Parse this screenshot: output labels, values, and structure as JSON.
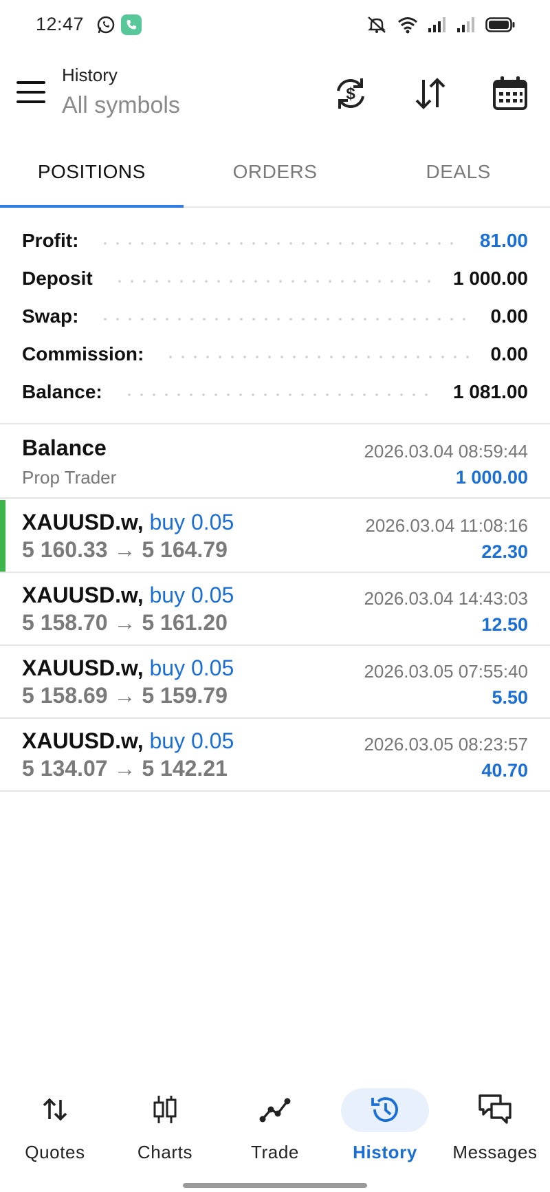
{
  "status_bar": {
    "time": "12:47",
    "icons": [
      "whatsapp-icon",
      "call-icon",
      "mute-icon",
      "wifi-icon",
      "signal-icon",
      "signal-icon",
      "battery-icon"
    ]
  },
  "header": {
    "title": "History",
    "subtitle": "All symbols",
    "actions": [
      "currency-sync-icon",
      "sort-icon",
      "calendar-icon"
    ]
  },
  "tabs": [
    {
      "label": "POSITIONS",
      "active": true
    },
    {
      "label": "ORDERS",
      "active": false
    },
    {
      "label": "DEALS",
      "active": false
    }
  ],
  "summary": {
    "profit": {
      "label": "Profit:",
      "value": "81.00"
    },
    "deposit": {
      "label": "Deposit",
      "value": "1 000.00"
    },
    "swap": {
      "label": "Swap:",
      "value": "0.00"
    },
    "commission": {
      "label": "Commission:",
      "value": "0.00"
    },
    "balance": {
      "label": "Balance:",
      "value": "1 081.00"
    }
  },
  "balance_entry": {
    "title": "Balance",
    "subtitle": "Prop Trader",
    "time": "2026.03.04 08:59:44",
    "amount": "1 000.00"
  },
  "positions": [
    {
      "symbol": "XAUUSD.w,",
      "type": "buy 0.05",
      "prices": "5 160.33 → 5 164.79",
      "time": "2026.03.04 11:08:16",
      "profit": "22.30"
    },
    {
      "symbol": "XAUUSD.w,",
      "type": "buy 0.05",
      "prices": "5 158.70 → 5 161.20",
      "time": "2026.03.04 14:43:03",
      "profit": "12.50"
    },
    {
      "symbol": "XAUUSD.w,",
      "type": "buy 0.05",
      "prices": "5 158.69 → 5 159.79",
      "time": "2026.03.05 07:55:40",
      "profit": "5.50"
    },
    {
      "symbol": "XAUUSD.w,",
      "type": "buy 0.05",
      "prices": "5 134.07 → 5 142.21",
      "time": "2026.03.05 08:23:57",
      "profit": "40.70"
    }
  ],
  "bottom_nav": [
    {
      "label": "Quotes",
      "icon": "quotes-arrows-icon",
      "active": false
    },
    {
      "label": "Charts",
      "icon": "candlestick-icon",
      "active": false
    },
    {
      "label": "Trade",
      "icon": "trade-line-icon",
      "active": false
    },
    {
      "label": "History",
      "icon": "history-clock-icon",
      "active": true
    },
    {
      "label": "Messages",
      "icon": "messages-icon",
      "active": false
    }
  ],
  "colors": {
    "accent_blue": "#1a6fd6",
    "tab_indicator": "#2f7ee0",
    "buy_marker_green": "#3cb64a",
    "muted_gray": "#7a7a7a"
  }
}
